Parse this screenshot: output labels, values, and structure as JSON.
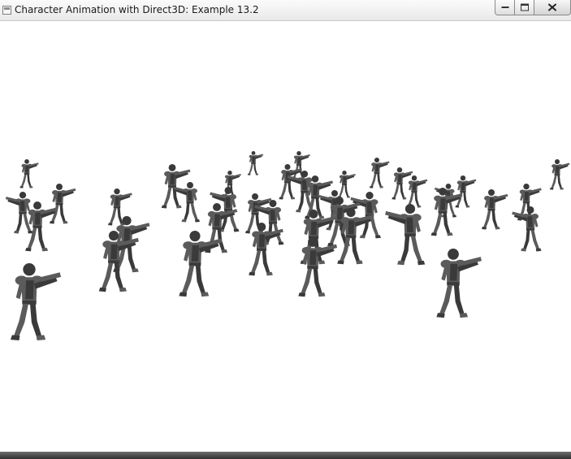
{
  "window": {
    "title": "Character Animation with Direct3D: Example 13.2",
    "icon": "app-window-icon",
    "controls": [
      {
        "name": "minimize-button",
        "icon": "minimize-icon"
      },
      {
        "name": "maximize-button",
        "icon": "maximize-icon"
      },
      {
        "name": "close-button",
        "icon": "close-icon"
      }
    ]
  },
  "scene": {
    "background_color": "#ffffff",
    "character_color": "#5b5b5b",
    "character_shade": "#3a3a3a"
  }
}
